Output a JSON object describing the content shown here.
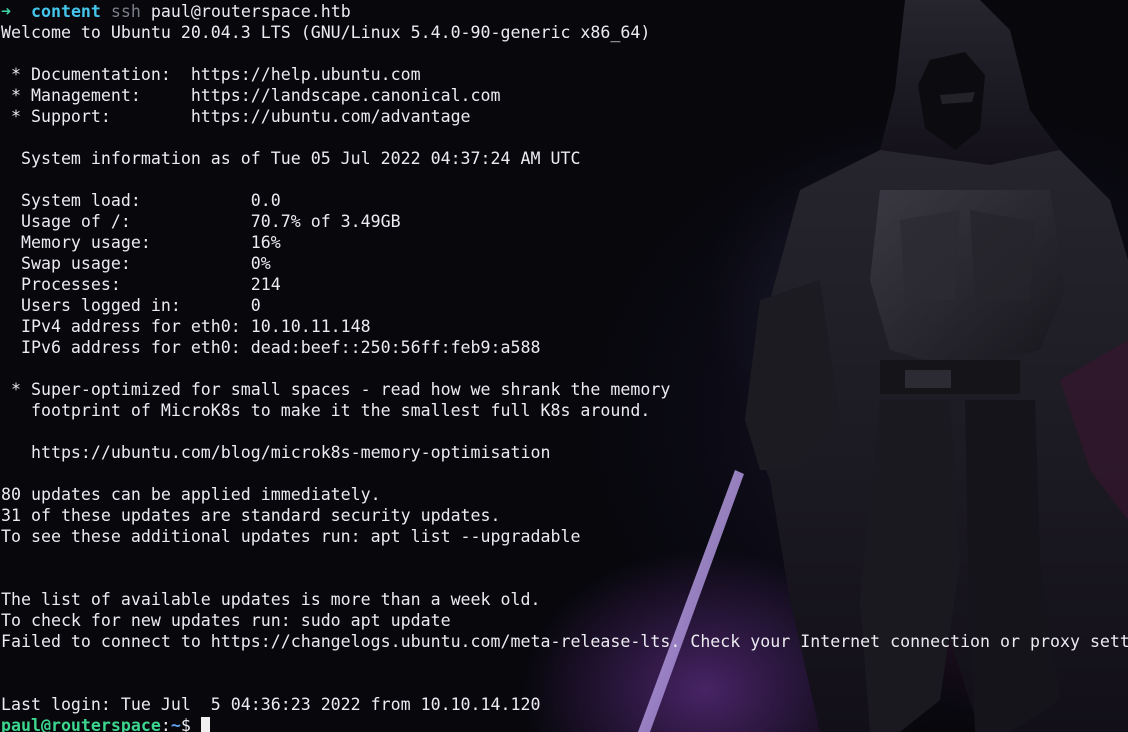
{
  "prompt": {
    "arrow": "➜",
    "dir": "content",
    "command": "ssh",
    "target": "paul@routerspace.htb"
  },
  "motd": {
    "welcome": "Welcome to Ubuntu 20.04.3 LTS (GNU/Linux 5.4.0-90-generic x86_64)",
    "documentation": " * Documentation:  https://help.ubuntu.com",
    "management": " * Management:     https://landscape.canonical.com",
    "support": " * Support:        https://ubuntu.com/advantage",
    "sysinfo_header": "  System information as of Tue 05 Jul 2022 04:37:24 AM UTC",
    "stats": [
      "  System load:           0.0",
      "  Usage of /:            70.7% of 3.49GB",
      "  Memory usage:          16%",
      "  Swap usage:            0%",
      "  Processes:             214",
      "  Users logged in:       0",
      "  IPv4 address for eth0: 10.10.11.148",
      "  IPv6 address for eth0: dead:beef::250:56ff:feb9:a588"
    ],
    "microk8s_1": " * Super-optimized for small spaces - read how we shrank the memory",
    "microk8s_2": "   footprint of MicroK8s to make it the smallest full K8s around.",
    "microk8s_url": "   https://ubuntu.com/blog/microk8s-memory-optimisation",
    "updates_1": "80 updates can be applied immediately.",
    "updates_2": "31 of these updates are standard security updates.",
    "updates_3": "To see these additional updates run: apt list --upgradable",
    "old_list_1": "The list of available updates is more than a week old.",
    "old_list_2": "To check for new updates run: sudo apt update",
    "old_list_3": "Failed to connect to https://changelogs.ubuntu.com/meta-release-lts. Check your Internet connection or proxy settings",
    "last_login": "Last login: Tue Jul  5 04:36:23 2022 from 10.10.14.120"
  },
  "shell_prompt": {
    "user_host": "paul@routerspace",
    "separator": ":",
    "path": "~",
    "symbol": "$ "
  },
  "colors": {
    "background": "#07070c",
    "text": "#ecebf1",
    "prompt_arrow": "#3fd6a2",
    "prompt_dir": "#44c6ea",
    "user_host": "#3dd68e",
    "path": "#5fa0f0"
  }
}
